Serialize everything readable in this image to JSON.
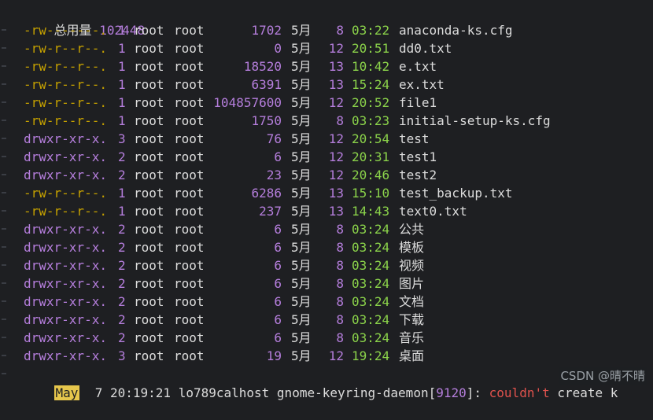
{
  "summary": {
    "label": "总用量",
    "value": "102448"
  },
  "rows": [
    {
      "perm": "-rw-------.",
      "links": "1",
      "user": "root",
      "group": "root",
      "size": "1702",
      "month": "5月",
      "day": "8",
      "time": "03:22",
      "name": "anaconda-ks.cfg",
      "dir": false
    },
    {
      "perm": "-rw-r--r--.",
      "links": "1",
      "user": "root",
      "group": "root",
      "size": "0",
      "month": "5月",
      "day": "12",
      "time": "20:51",
      "name": "dd0.txt",
      "dir": false
    },
    {
      "perm": "-rw-r--r--.",
      "links": "1",
      "user": "root",
      "group": "root",
      "size": "18520",
      "month": "5月",
      "day": "13",
      "time": "10:42",
      "name": "e.txt",
      "dir": false
    },
    {
      "perm": "-rw-r--r--.",
      "links": "1",
      "user": "root",
      "group": "root",
      "size": "6391",
      "month": "5月",
      "day": "13",
      "time": "15:24",
      "name": "ex.txt",
      "dir": false
    },
    {
      "perm": "-rw-r--r--.",
      "links": "1",
      "user": "root",
      "group": "root",
      "size": "104857600",
      "month": "5月",
      "day": "12",
      "time": "20:52",
      "name": "file1",
      "dir": false
    },
    {
      "perm": "-rw-r--r--.",
      "links": "1",
      "user": "root",
      "group": "root",
      "size": "1750",
      "month": "5月",
      "day": "8",
      "time": "03:23",
      "name": "initial-setup-ks.cfg",
      "dir": false
    },
    {
      "perm": "drwxr-xr-x.",
      "links": "3",
      "user": "root",
      "group": "root",
      "size": "76",
      "month": "5月",
      "day": "12",
      "time": "20:54",
      "name": "test",
      "dir": true
    },
    {
      "perm": "drwxr-xr-x.",
      "links": "2",
      "user": "root",
      "group": "root",
      "size": "6",
      "month": "5月",
      "day": "12",
      "time": "20:31",
      "name": "test1",
      "dir": true
    },
    {
      "perm": "drwxr-xr-x.",
      "links": "2",
      "user": "root",
      "group": "root",
      "size": "23",
      "month": "5月",
      "day": "12",
      "time": "20:46",
      "name": "test2",
      "dir": true
    },
    {
      "perm": "-rw-r--r--.",
      "links": "1",
      "user": "root",
      "group": "root",
      "size": "6286",
      "month": "5月",
      "day": "13",
      "time": "15:10",
      "name": "test_backup.txt",
      "dir": false
    },
    {
      "perm": "-rw-r--r--.",
      "links": "1",
      "user": "root",
      "group": "root",
      "size": "237",
      "month": "5月",
      "day": "13",
      "time": "14:43",
      "name": "text0.txt",
      "dir": false
    },
    {
      "perm": "drwxr-xr-x.",
      "links": "2",
      "user": "root",
      "group": "root",
      "size": "6",
      "month": "5月",
      "day": "8",
      "time": "03:24",
      "name": "公共",
      "dir": true
    },
    {
      "perm": "drwxr-xr-x.",
      "links": "2",
      "user": "root",
      "group": "root",
      "size": "6",
      "month": "5月",
      "day": "8",
      "time": "03:24",
      "name": "模板",
      "dir": true
    },
    {
      "perm": "drwxr-xr-x.",
      "links": "2",
      "user": "root",
      "group": "root",
      "size": "6",
      "month": "5月",
      "day": "8",
      "time": "03:24",
      "name": "视频",
      "dir": true
    },
    {
      "perm": "drwxr-xr-x.",
      "links": "2",
      "user": "root",
      "group": "root",
      "size": "6",
      "month": "5月",
      "day": "8",
      "time": "03:24",
      "name": "图片",
      "dir": true
    },
    {
      "perm": "drwxr-xr-x.",
      "links": "2",
      "user": "root",
      "group": "root",
      "size": "6",
      "month": "5月",
      "day": "8",
      "time": "03:24",
      "name": "文档",
      "dir": true
    },
    {
      "perm": "drwxr-xr-x.",
      "links": "2",
      "user": "root",
      "group": "root",
      "size": "6",
      "month": "5月",
      "day": "8",
      "time": "03:24",
      "name": "下载",
      "dir": true
    },
    {
      "perm": "drwxr-xr-x.",
      "links": "2",
      "user": "root",
      "group": "root",
      "size": "6",
      "month": "5月",
      "day": "8",
      "time": "03:24",
      "name": "音乐",
      "dir": true
    },
    {
      "perm": "drwxr-xr-x.",
      "links": "3",
      "user": "root",
      "group": "root",
      "size": "19",
      "month": "5月",
      "day": "12",
      "time": "19:24",
      "name": "桌面",
      "dir": true
    }
  ],
  "log_line": {
    "month": "May",
    "day": "7",
    "time": "20:19:21",
    "host": "lo789calhost",
    "proc": "gnome-keyring-daemon",
    "pid_open": "[",
    "pid": "9120",
    "pid_close": "]:",
    "msg": "couldn't",
    "msg_rest": "create",
    "tail": "k"
  },
  "watermark": "CSDN @晴不晴",
  "colors": {
    "background": "#1e1f22",
    "text": "#dcdcdc",
    "number": "#b57edc",
    "time": "#8bd34a",
    "file_perm": "#c4a000",
    "error": "#e0524d",
    "highlight": "#e6c64c"
  }
}
